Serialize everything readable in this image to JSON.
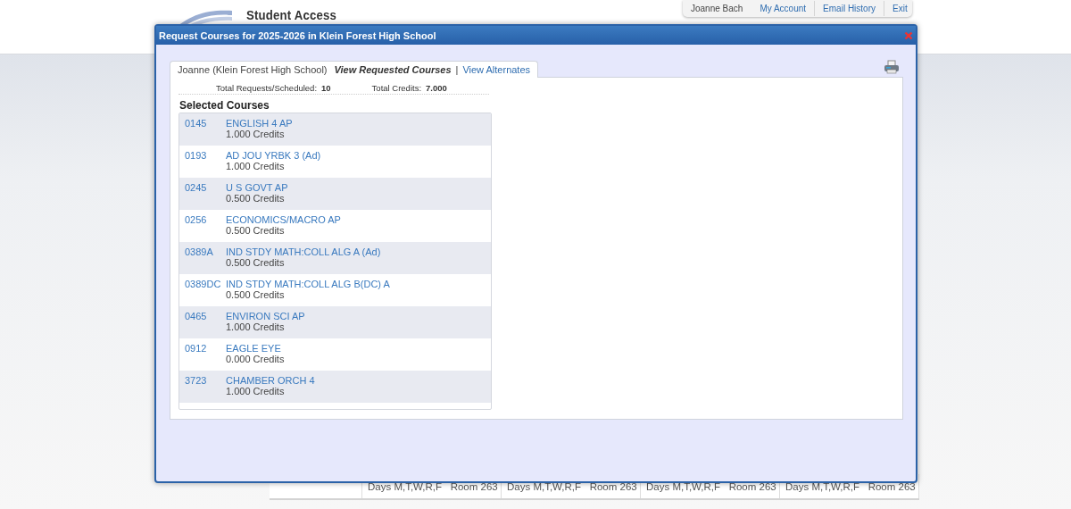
{
  "header": {
    "logo_text": "Student Access",
    "user_name": "Joanne Bach",
    "links": [
      "My Account",
      "Email History",
      "Exit"
    ]
  },
  "background_schedule": {
    "cells": [
      "Days M,T,W,R,F   Room 263",
      "Days M,T,W,R,F   Room 263",
      "Days M,T,W,R,F   Room 263",
      "Days M,T,W,R,F   Room 263"
    ]
  },
  "dialog": {
    "title": "Request Courses for 2025-2026 in Klein Forest High School",
    "tab": {
      "student": "Joanne (Klein Forest High School)",
      "active_label": "View Requested Courses",
      "separator": "|",
      "link": "View Alternates"
    },
    "totals": {
      "requests_label": "Total Requests/Scheduled:",
      "requests_value": "10",
      "credits_label": "Total Credits:",
      "credits_value": "7.000"
    },
    "section_title": "Selected Courses",
    "courses": [
      {
        "code": "0145",
        "name": "ENGLISH 4 AP",
        "credits": "1.000 Credits"
      },
      {
        "code": "0193",
        "name": "AD JOU YRBK 3 (Ad)",
        "credits": "1.000 Credits"
      },
      {
        "code": "0245",
        "name": "U S GOVT AP",
        "credits": "0.500 Credits"
      },
      {
        "code": "0256",
        "name": "ECONOMICS/MACRO AP",
        "credits": "0.500 Credits"
      },
      {
        "code": "0389A",
        "name": "IND STDY MATH:COLL ALG A (Ad)",
        "credits": "0.500 Credits"
      },
      {
        "code": "0389DC",
        "name": "IND STDY MATH:COLL ALG B(DC) A",
        "credits": "0.500 Credits"
      },
      {
        "code": "0465",
        "name": "ENVIRON SCI AP",
        "credits": "1.000 Credits"
      },
      {
        "code": "0912",
        "name": "EAGLE EYE",
        "credits": "0.000 Credits"
      },
      {
        "code": "3723",
        "name": "CHAMBER ORCH 4",
        "credits": "1.000 Credits"
      }
    ]
  }
}
